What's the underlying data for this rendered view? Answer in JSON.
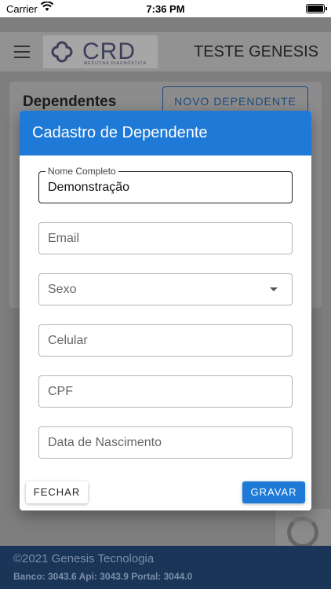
{
  "status_bar": {
    "carrier": "Carrier",
    "time": "7:36 PM"
  },
  "header": {
    "logo_text": "CRD",
    "logo_subtitle": "MEDICINA DIAGNÓSTICA",
    "user_name": "TESTE GENESIS"
  },
  "page": {
    "title": "Dependentes",
    "new_button_label": "NOVO DEPENDENTE"
  },
  "dialog": {
    "title": "Cadastro de Dependente",
    "fields": {
      "name": {
        "label": "Nome Completo",
        "value": "Demonstração"
      },
      "email": {
        "placeholder": "Email"
      },
      "sex": {
        "placeholder": "Sexo"
      },
      "phone": {
        "placeholder": "Celular"
      },
      "cpf": {
        "placeholder": "CPF"
      },
      "birth": {
        "placeholder": "Data de Nascimento"
      }
    },
    "close_label": "FECHAR",
    "save_label": "GRAVAR"
  },
  "footer": {
    "copyright": "©2021 Genesis Tecnologia",
    "versions": "Banco: 3043.6 Api: 3043.9 Portal: 3044.0"
  },
  "colors": {
    "primary": "#1e7ad6",
    "footer_bg": "#1a3558",
    "logo": "#3d3f5a"
  }
}
